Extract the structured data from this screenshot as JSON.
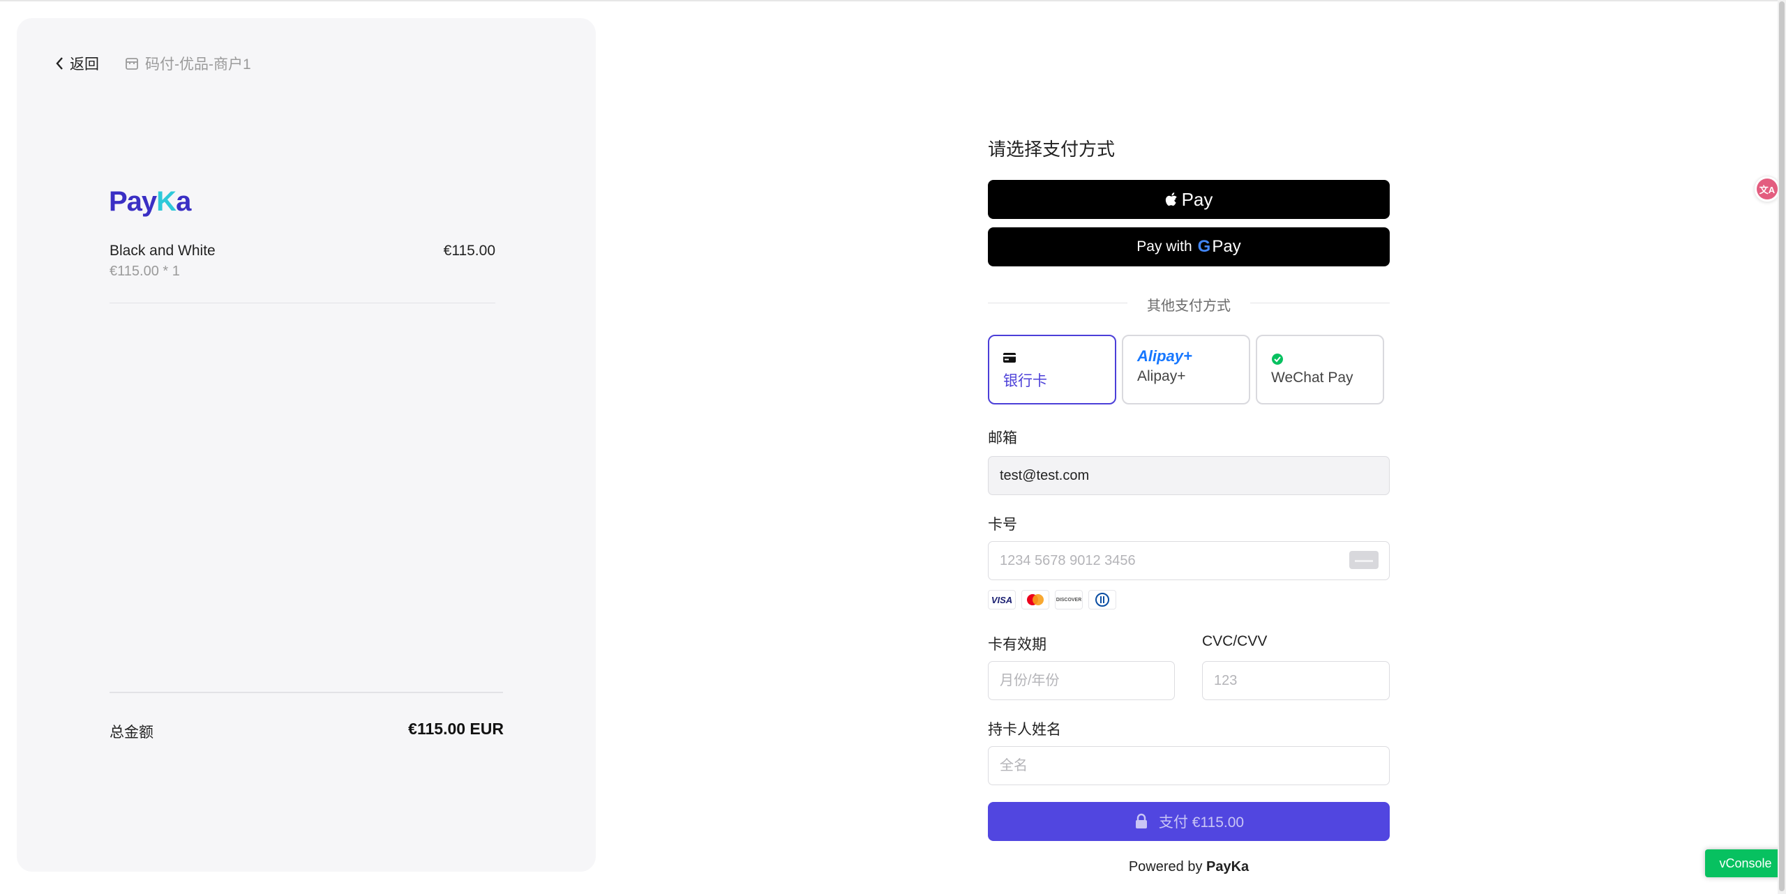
{
  "left": {
    "back_label": "返回",
    "merchant_name": "码付-优品-商户1",
    "logo": {
      "text_main": "Pay",
      "text_k": "K",
      "text_end": "a"
    },
    "item": {
      "name": "Black and White",
      "price": "€115.00",
      "qty_line": "€115.00 * 1"
    },
    "total": {
      "label": "总金额",
      "value": "€115.00 EUR"
    }
  },
  "form": {
    "heading": "请选择支付方式",
    "apple_pay_label": "Pay",
    "google_pay_prefix": "Pay with",
    "google_pay_g": "G",
    "google_pay_suffix": "Pay",
    "other_methods": "其他支付方式",
    "methods": [
      {
        "label": "银行卡",
        "active": true
      },
      {
        "logo": "Alipay+",
        "label": "Alipay+",
        "active": false
      },
      {
        "label": "WeChat Pay",
        "active": false
      }
    ],
    "email": {
      "label": "邮箱",
      "value": "test@test.com"
    },
    "card_number": {
      "label": "卡号",
      "placeholder": "1234 5678 9012 3456"
    },
    "card_brands": [
      "VISA",
      "mastercard",
      "DISCOVER",
      "diners"
    ],
    "expiry": {
      "label": "卡有效期",
      "placeholder": "月份/年份"
    },
    "cvc": {
      "label": "CVC/CVV",
      "placeholder": "123"
    },
    "holder": {
      "label": "持卡人姓名",
      "placeholder": "全名"
    },
    "pay_button": "支付 €115.00",
    "powered_prefix": "Powered by",
    "powered_brand": "PayKa"
  },
  "overlay": {
    "vconsole_label": "vConsole",
    "translate_glyph": "文A"
  },
  "colors": {
    "accent": "#5146e0",
    "active_border": "#4b3fd8",
    "brand_purple": "#3a2fc4",
    "brand_teal": "#2ec9d9",
    "vconsole_green": "#07c160"
  }
}
